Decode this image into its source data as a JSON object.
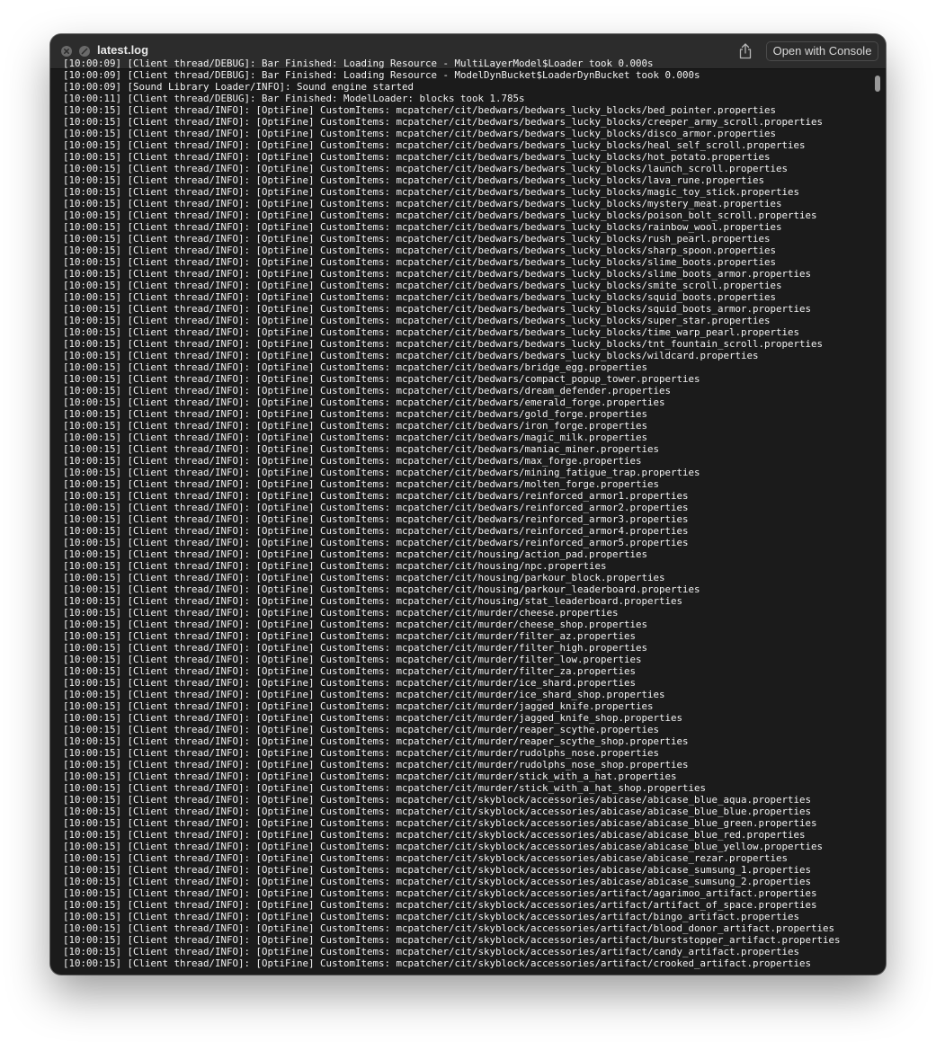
{
  "window": {
    "title": "latest.log",
    "open_button_label": "Open with Console"
  },
  "icons": {
    "close": "close-icon",
    "minimize": "minimize-icon",
    "share": "share-icon"
  },
  "log_lines": [
    "[10:00:09] [Client thread/DEBUG]: Bar Finished: Loading Resource - MultiLayerModel$Loader took 0.000s",
    "[10:00:09] [Client thread/DEBUG]: Bar Finished: Loading Resource - ModelDynBucket$LoaderDynBucket took 0.000s",
    "[10:00:09] [Sound Library Loader/INFO]: Sound engine started",
    "[10:00:11] [Client thread/DEBUG]: Bar Finished: ModelLoader: blocks took 1.785s",
    "[10:00:15] [Client thread/INFO]: [OptiFine] CustomItems: mcpatcher/cit/bedwars/bedwars_lucky_blocks/bed_pointer.properties",
    "[10:00:15] [Client thread/INFO]: [OptiFine] CustomItems: mcpatcher/cit/bedwars/bedwars_lucky_blocks/creeper_army_scroll.properties",
    "[10:00:15] [Client thread/INFO]: [OptiFine] CustomItems: mcpatcher/cit/bedwars/bedwars_lucky_blocks/disco_armor.properties",
    "[10:00:15] [Client thread/INFO]: [OptiFine] CustomItems: mcpatcher/cit/bedwars/bedwars_lucky_blocks/heal_self_scroll.properties",
    "[10:00:15] [Client thread/INFO]: [OptiFine] CustomItems: mcpatcher/cit/bedwars/bedwars_lucky_blocks/hot_potato.properties",
    "[10:00:15] [Client thread/INFO]: [OptiFine] CustomItems: mcpatcher/cit/bedwars/bedwars_lucky_blocks/launch_scroll.properties",
    "[10:00:15] [Client thread/INFO]: [OptiFine] CustomItems: mcpatcher/cit/bedwars/bedwars_lucky_blocks/lava_rune.properties",
    "[10:00:15] [Client thread/INFO]: [OptiFine] CustomItems: mcpatcher/cit/bedwars/bedwars_lucky_blocks/magic_toy_stick.properties",
    "[10:00:15] [Client thread/INFO]: [OptiFine] CustomItems: mcpatcher/cit/bedwars/bedwars_lucky_blocks/mystery_meat.properties",
    "[10:00:15] [Client thread/INFO]: [OptiFine] CustomItems: mcpatcher/cit/bedwars/bedwars_lucky_blocks/poison_bolt_scroll.properties",
    "[10:00:15] [Client thread/INFO]: [OptiFine] CustomItems: mcpatcher/cit/bedwars/bedwars_lucky_blocks/rainbow_wool.properties",
    "[10:00:15] [Client thread/INFO]: [OptiFine] CustomItems: mcpatcher/cit/bedwars/bedwars_lucky_blocks/rush_pearl.properties",
    "[10:00:15] [Client thread/INFO]: [OptiFine] CustomItems: mcpatcher/cit/bedwars/bedwars_lucky_blocks/sharp_spoon.properties",
    "[10:00:15] [Client thread/INFO]: [OptiFine] CustomItems: mcpatcher/cit/bedwars/bedwars_lucky_blocks/slime_boots.properties",
    "[10:00:15] [Client thread/INFO]: [OptiFine] CustomItems: mcpatcher/cit/bedwars/bedwars_lucky_blocks/slime_boots_armor.properties",
    "[10:00:15] [Client thread/INFO]: [OptiFine] CustomItems: mcpatcher/cit/bedwars/bedwars_lucky_blocks/smite_scroll.properties",
    "[10:00:15] [Client thread/INFO]: [OptiFine] CustomItems: mcpatcher/cit/bedwars/bedwars_lucky_blocks/squid_boots.properties",
    "[10:00:15] [Client thread/INFO]: [OptiFine] CustomItems: mcpatcher/cit/bedwars/bedwars_lucky_blocks/squid_boots_armor.properties",
    "[10:00:15] [Client thread/INFO]: [OptiFine] CustomItems: mcpatcher/cit/bedwars/bedwars_lucky_blocks/super_star.properties",
    "[10:00:15] [Client thread/INFO]: [OptiFine] CustomItems: mcpatcher/cit/bedwars/bedwars_lucky_blocks/time_warp_pearl.properties",
    "[10:00:15] [Client thread/INFO]: [OptiFine] CustomItems: mcpatcher/cit/bedwars/bedwars_lucky_blocks/tnt_fountain_scroll.properties",
    "[10:00:15] [Client thread/INFO]: [OptiFine] CustomItems: mcpatcher/cit/bedwars/bedwars_lucky_blocks/wildcard.properties",
    "[10:00:15] [Client thread/INFO]: [OptiFine] CustomItems: mcpatcher/cit/bedwars/bridge_egg.properties",
    "[10:00:15] [Client thread/INFO]: [OptiFine] CustomItems: mcpatcher/cit/bedwars/compact_popup_tower.properties",
    "[10:00:15] [Client thread/INFO]: [OptiFine] CustomItems: mcpatcher/cit/bedwars/dream_defender.properties",
    "[10:00:15] [Client thread/INFO]: [OptiFine] CustomItems: mcpatcher/cit/bedwars/emerald_forge.properties",
    "[10:00:15] [Client thread/INFO]: [OptiFine] CustomItems: mcpatcher/cit/bedwars/gold_forge.properties",
    "[10:00:15] [Client thread/INFO]: [OptiFine] CustomItems: mcpatcher/cit/bedwars/iron_forge.properties",
    "[10:00:15] [Client thread/INFO]: [OptiFine] CustomItems: mcpatcher/cit/bedwars/magic_milk.properties",
    "[10:00:15] [Client thread/INFO]: [OptiFine] CustomItems: mcpatcher/cit/bedwars/maniac_miner.properties",
    "[10:00:15] [Client thread/INFO]: [OptiFine] CustomItems: mcpatcher/cit/bedwars/max_forge.properties",
    "[10:00:15] [Client thread/INFO]: [OptiFine] CustomItems: mcpatcher/cit/bedwars/mining_fatigue_trap.properties",
    "[10:00:15] [Client thread/INFO]: [OptiFine] CustomItems: mcpatcher/cit/bedwars/molten_forge.properties",
    "[10:00:15] [Client thread/INFO]: [OptiFine] CustomItems: mcpatcher/cit/bedwars/reinforced_armor1.properties",
    "[10:00:15] [Client thread/INFO]: [OptiFine] CustomItems: mcpatcher/cit/bedwars/reinforced_armor2.properties",
    "[10:00:15] [Client thread/INFO]: [OptiFine] CustomItems: mcpatcher/cit/bedwars/reinforced_armor3.properties",
    "[10:00:15] [Client thread/INFO]: [OptiFine] CustomItems: mcpatcher/cit/bedwars/reinforced_armor4.properties",
    "[10:00:15] [Client thread/INFO]: [OptiFine] CustomItems: mcpatcher/cit/bedwars/reinforced_armor5.properties",
    "[10:00:15] [Client thread/INFO]: [OptiFine] CustomItems: mcpatcher/cit/housing/action_pad.properties",
    "[10:00:15] [Client thread/INFO]: [OptiFine] CustomItems: mcpatcher/cit/housing/npc.properties",
    "[10:00:15] [Client thread/INFO]: [OptiFine] CustomItems: mcpatcher/cit/housing/parkour_block.properties",
    "[10:00:15] [Client thread/INFO]: [OptiFine] CustomItems: mcpatcher/cit/housing/parkour_leaderboard.properties",
    "[10:00:15] [Client thread/INFO]: [OptiFine] CustomItems: mcpatcher/cit/housing/stat_leaderboard.properties",
    "[10:00:15] [Client thread/INFO]: [OptiFine] CustomItems: mcpatcher/cit/murder/cheese.properties",
    "[10:00:15] [Client thread/INFO]: [OptiFine] CustomItems: mcpatcher/cit/murder/cheese_shop.properties",
    "[10:00:15] [Client thread/INFO]: [OptiFine] CustomItems: mcpatcher/cit/murder/filter_az.properties",
    "[10:00:15] [Client thread/INFO]: [OptiFine] CustomItems: mcpatcher/cit/murder/filter_high.properties",
    "[10:00:15] [Client thread/INFO]: [OptiFine] CustomItems: mcpatcher/cit/murder/filter_low.properties",
    "[10:00:15] [Client thread/INFO]: [OptiFine] CustomItems: mcpatcher/cit/murder/filter_za.properties",
    "[10:00:15] [Client thread/INFO]: [OptiFine] CustomItems: mcpatcher/cit/murder/ice_shard.properties",
    "[10:00:15] [Client thread/INFO]: [OptiFine] CustomItems: mcpatcher/cit/murder/ice_shard_shop.properties",
    "[10:00:15] [Client thread/INFO]: [OptiFine] CustomItems: mcpatcher/cit/murder/jagged_knife.properties",
    "[10:00:15] [Client thread/INFO]: [OptiFine] CustomItems: mcpatcher/cit/murder/jagged_knife_shop.properties",
    "[10:00:15] [Client thread/INFO]: [OptiFine] CustomItems: mcpatcher/cit/murder/reaper_scythe.properties",
    "[10:00:15] [Client thread/INFO]: [OptiFine] CustomItems: mcpatcher/cit/murder/reaper_scythe_shop.properties",
    "[10:00:15] [Client thread/INFO]: [OptiFine] CustomItems: mcpatcher/cit/murder/rudolphs_nose.properties",
    "[10:00:15] [Client thread/INFO]: [OptiFine] CustomItems: mcpatcher/cit/murder/rudolphs_nose_shop.properties",
    "[10:00:15] [Client thread/INFO]: [OptiFine] CustomItems: mcpatcher/cit/murder/stick_with_a_hat.properties",
    "[10:00:15] [Client thread/INFO]: [OptiFine] CustomItems: mcpatcher/cit/murder/stick_with_a_hat_shop.properties",
    "[10:00:15] [Client thread/INFO]: [OptiFine] CustomItems: mcpatcher/cit/skyblock/accessories/abicase/abicase_blue_aqua.properties",
    "[10:00:15] [Client thread/INFO]: [OptiFine] CustomItems: mcpatcher/cit/skyblock/accessories/abicase/abicase_blue_blue.properties",
    "[10:00:15] [Client thread/INFO]: [OptiFine] CustomItems: mcpatcher/cit/skyblock/accessories/abicase/abicase_blue_green.properties",
    "[10:00:15] [Client thread/INFO]: [OptiFine] CustomItems: mcpatcher/cit/skyblock/accessories/abicase/abicase_blue_red.properties",
    "[10:00:15] [Client thread/INFO]: [OptiFine] CustomItems: mcpatcher/cit/skyblock/accessories/abicase/abicase_blue_yellow.properties",
    "[10:00:15] [Client thread/INFO]: [OptiFine] CustomItems: mcpatcher/cit/skyblock/accessories/abicase/abicase_rezar.properties",
    "[10:00:15] [Client thread/INFO]: [OptiFine] CustomItems: mcpatcher/cit/skyblock/accessories/abicase/abicase_sumsung_1.properties",
    "[10:00:15] [Client thread/INFO]: [OptiFine] CustomItems: mcpatcher/cit/skyblock/accessories/abicase/abicase_sumsung_2.properties",
    "[10:00:15] [Client thread/INFO]: [OptiFine] CustomItems: mcpatcher/cit/skyblock/accessories/artifact/agarimoo_artifact.properties",
    "[10:00:15] [Client thread/INFO]: [OptiFine] CustomItems: mcpatcher/cit/skyblock/accessories/artifact/artifact_of_space.properties",
    "[10:00:15] [Client thread/INFO]: [OptiFine] CustomItems: mcpatcher/cit/skyblock/accessories/artifact/bingo_artifact.properties",
    "[10:00:15] [Client thread/INFO]: [OptiFine] CustomItems: mcpatcher/cit/skyblock/accessories/artifact/blood_donor_artifact.properties",
    "[10:00:15] [Client thread/INFO]: [OptiFine] CustomItems: mcpatcher/cit/skyblock/accessories/artifact/burststopper_artifact.properties",
    "[10:00:15] [Client thread/INFO]: [OptiFine] CustomItems: mcpatcher/cit/skyblock/accessories/artifact/candy_artifact.properties",
    "[10:00:15] [Client thread/INFO]: [OptiFine] CustomItems: mcpatcher/cit/skyblock/accessories/artifact/crooked_artifact.properties"
  ]
}
